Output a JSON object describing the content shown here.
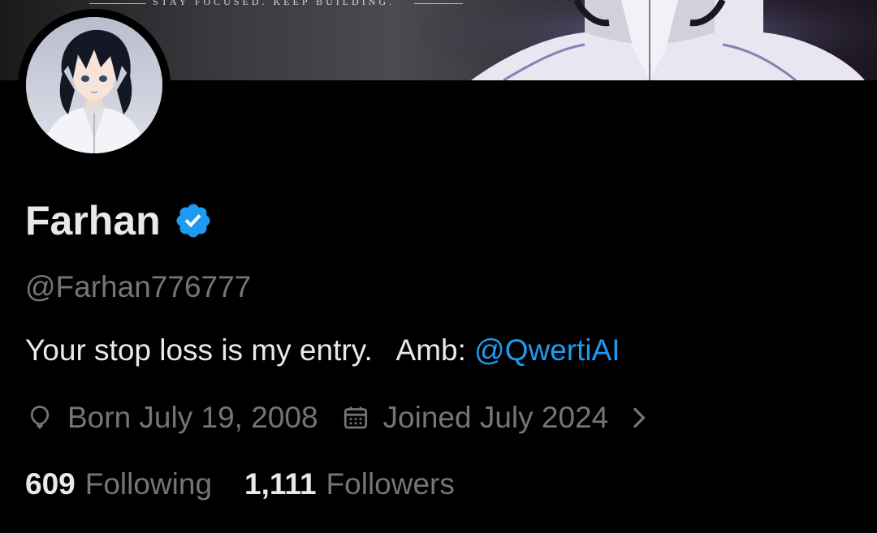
{
  "banner": {
    "tagline": "STAY FOCUSED. KEEP BUILDING."
  },
  "profile": {
    "display_name": "Farhan",
    "verified_icon": "verified-badge-icon",
    "handle": "@Farhan776777",
    "bio_text": "Your stop loss is my entry.   Amb: ",
    "bio_mention": "@QwertiAI",
    "birthdate": "Born July 19, 2008",
    "joined": "Joined July 2024",
    "following_count": "609",
    "following_label": "Following",
    "followers_count": "1,111",
    "followers_label": "Followers"
  },
  "colors": {
    "background": "#000000",
    "text_primary": "#e7e9ea",
    "text_secondary": "#71767b",
    "accent": "#1d9bf0"
  }
}
